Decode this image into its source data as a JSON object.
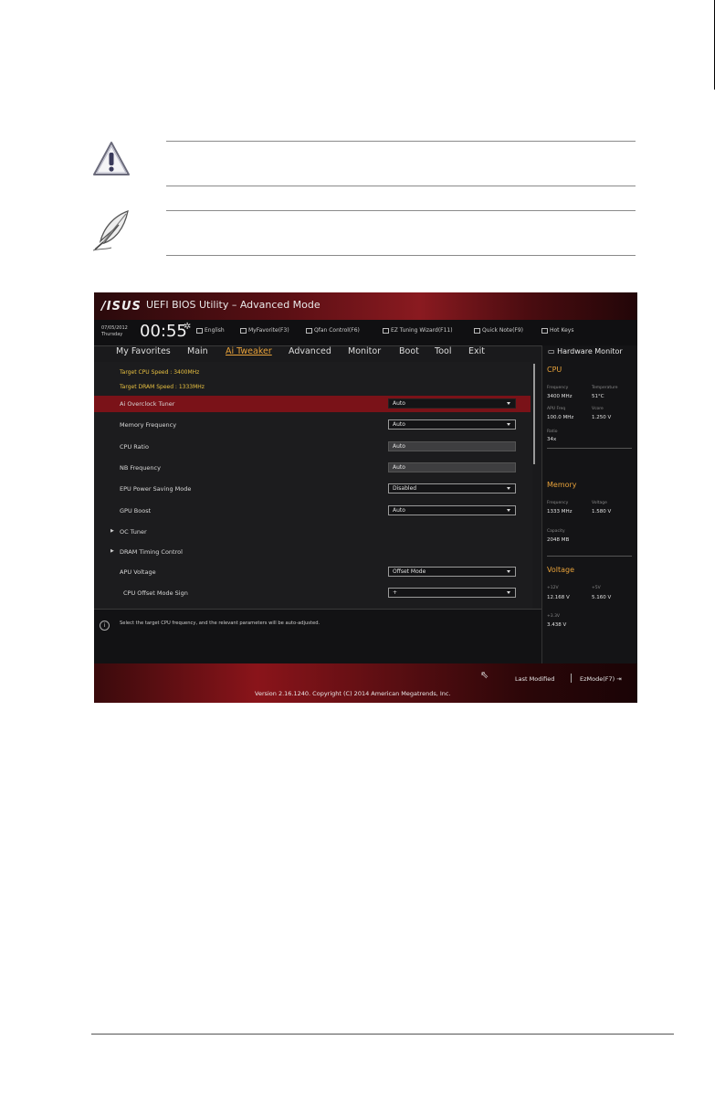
{
  "bios": {
    "logo": "/ISUS",
    "title": "UEFI BIOS Utility – Advanced Mode",
    "date": "07/05/2012",
    "weekday": "Thursday",
    "clock": "00:55",
    "toolbar": [
      "English",
      "MyFavorite(F3)",
      "Qfan Control(F6)",
      "EZ Tuning Wizard(F11)",
      "Quick Note(F9)",
      "Hot Keys"
    ],
    "tabs": [
      "My Favorites",
      "Main",
      "Ai Tweaker",
      "Advanced",
      "Monitor",
      "Boot",
      "Tool",
      "Exit"
    ],
    "active_tab": "Ai Tweaker",
    "target_cpu": "Target CPU Speed : 3400MHz",
    "target_dram": "Target DRAM Speed : 1333MHz",
    "settings": [
      {
        "label": "Ai Overclock Tuner",
        "value": "Auto"
      },
      {
        "label": "Memory Frequency",
        "value": "Auto"
      },
      {
        "label": "CPU Ratio",
        "value": "Auto"
      },
      {
        "label": "NB Frequency",
        "value": "Auto"
      },
      {
        "label": "EPU Power Saving Mode",
        "value": "Disabled"
      },
      {
        "label": "GPU Boost",
        "value": "Auto"
      },
      {
        "label": "OC Tuner"
      },
      {
        "label": "DRAM Timing Control"
      },
      {
        "label": "APU Voltage",
        "value": "Offset Mode"
      },
      {
        "label": "CPU Offset Mode Sign",
        "value": "+"
      }
    ],
    "help_text": "Select the target CPU frequency, and the relevant parameters will be auto-adjusted.",
    "hardware_monitor": {
      "title": "Hardware Monitor",
      "cpu": {
        "heading": "CPU",
        "frequency_label": "Frequency",
        "frequency": "3400 MHz",
        "temperature_label": "Temperature",
        "temperature": "51°C",
        "apu_freq_label": "APU Freq",
        "apu_freq": "100.0 MHz",
        "vcore_label": "Vcore",
        "vcore": "1.250 V",
        "ratio_label": "Ratio",
        "ratio": "34x"
      },
      "memory": {
        "heading": "Memory",
        "frequency_label": "Frequency",
        "frequency": "1333 MHz",
        "voltage_label": "Voltage",
        "voltage": "1.580 V",
        "capacity_label": "Capacity",
        "capacity": "2048 MB"
      },
      "voltage": {
        "heading": "Voltage",
        "v12_label": "+12V",
        "v12": "12.168 V",
        "v5_label": "+5V",
        "v5": "5.160 V",
        "v33_label": "+3.3V",
        "v33": "3.438 V"
      }
    },
    "last_modified": "Last Modified",
    "ezmode": "EzMode(F7)",
    "version": "Version 2.16.1240. Copyright (C) 2014 American Megatrends, Inc."
  }
}
